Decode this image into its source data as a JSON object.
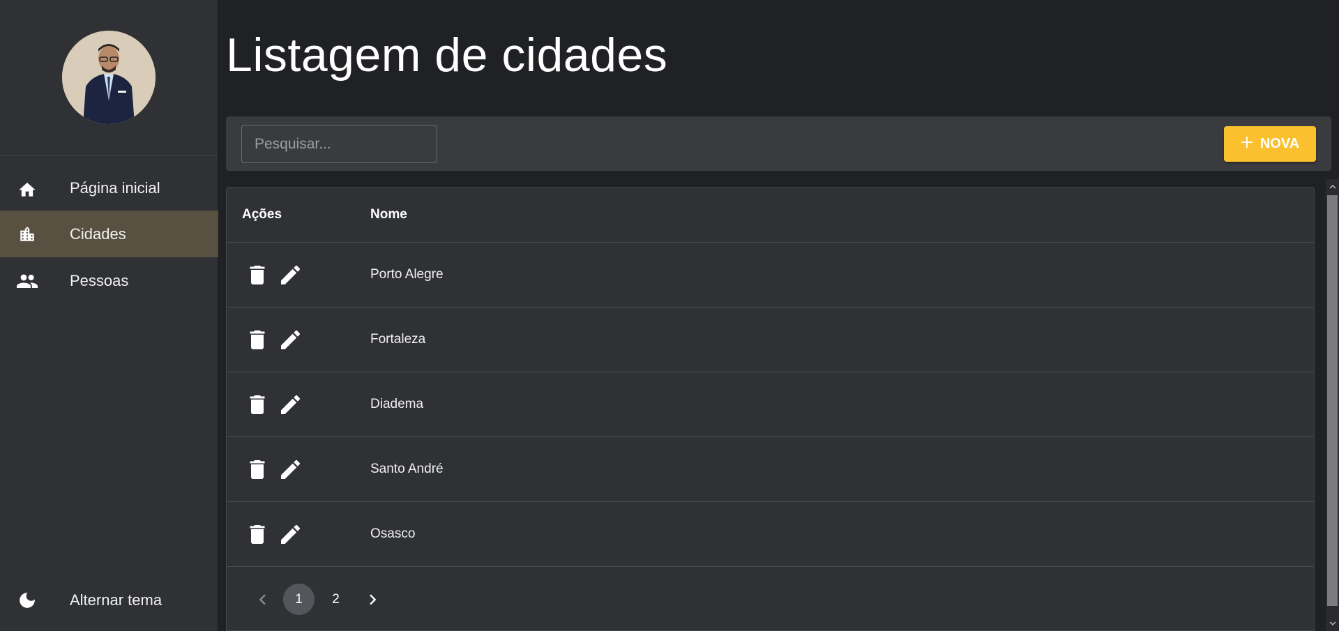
{
  "sidebar": {
    "nav": [
      {
        "label": "Página inicial",
        "icon": "home-icon"
      },
      {
        "label": "Cidades",
        "icon": "city-icon",
        "active": true
      },
      {
        "label": "Pessoas",
        "icon": "people-icon"
      }
    ],
    "theme_toggle": {
      "label": "Alternar tema",
      "icon": "moon-icon"
    }
  },
  "main": {
    "title": "Listagem de cidades",
    "search": {
      "placeholder": "Pesquisar...",
      "value": ""
    },
    "new_button": {
      "label": "NOVA",
      "icon": "plus-icon",
      "color": "#fbc02d"
    },
    "table": {
      "headers": [
        "Ações",
        "Nome"
      ],
      "rows": [
        {
          "name": "Porto Alegre"
        },
        {
          "name": "Fortaleza"
        },
        {
          "name": "Diadema"
        },
        {
          "name": "Santo André"
        },
        {
          "name": "Osasco"
        }
      ]
    },
    "pagination": {
      "pages": [
        "1",
        "2"
      ],
      "current": "1"
    }
  },
  "colors": {
    "background": "#202124",
    "sidebar": "#303134",
    "active_nav": "#585040",
    "accent": "#fbc02d"
  }
}
